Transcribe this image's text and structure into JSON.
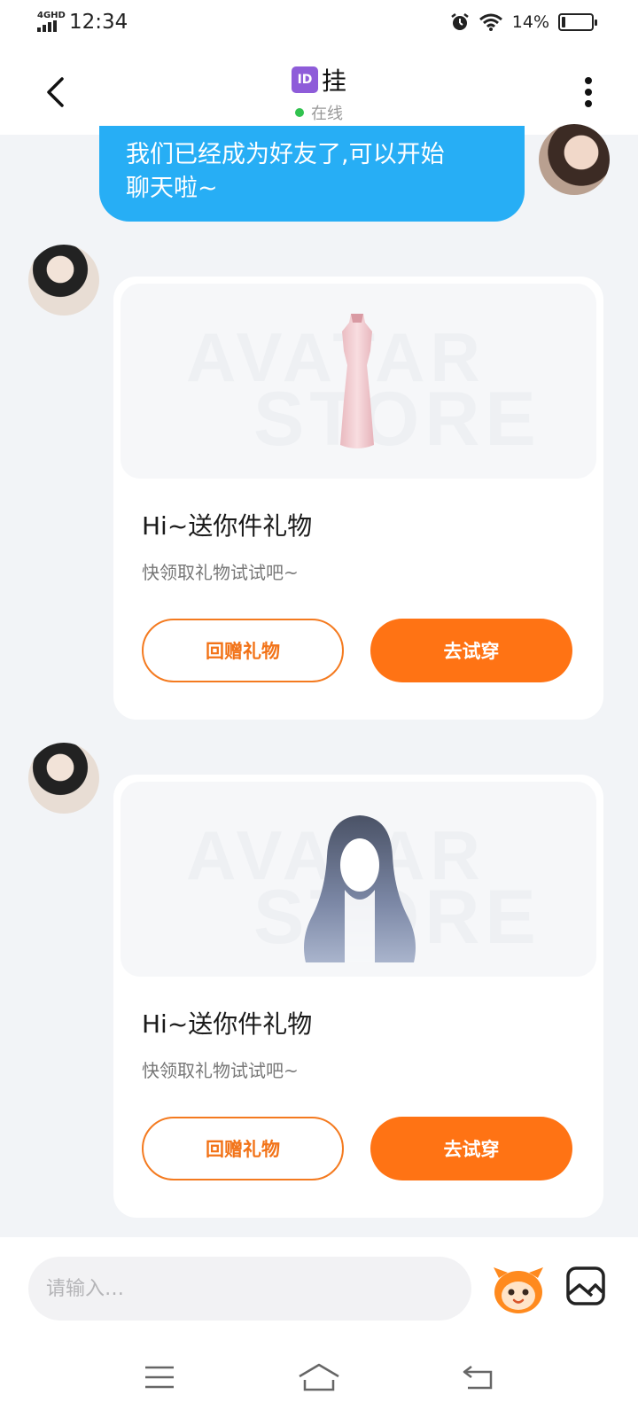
{
  "status_bar": {
    "network": "4GHD",
    "time": "12:34",
    "battery_text": "14%",
    "battery_level": 0.14
  },
  "header": {
    "id_badge": "ID",
    "name": "挂",
    "status": "在线",
    "status_color": "#31c24f"
  },
  "messages": {
    "my_text": "我们已经成为好友了,可以开始聊天啦~",
    "my_text_line1": "我们已经成为好友了,可以开始",
    "my_text_line2": "聊天啦~",
    "bubble_color": "#27aef5"
  },
  "gifts": [
    {
      "item": "dress",
      "watermark_1": "AVATAR",
      "watermark_2": "STORE",
      "title": "Hi~送你件礼物",
      "subtitle": "快领取礼物试试吧~",
      "return_gift_label": "回赠礼物",
      "try_on_label": "去试穿"
    },
    {
      "item": "wig",
      "watermark_1": "AVATAR",
      "watermark_2": "STORE",
      "title": "Hi~送你件礼物",
      "subtitle": "快领取礼物试试吧~",
      "return_gift_label": "回赠礼物",
      "try_on_label": "去试穿"
    }
  ],
  "input": {
    "placeholder": "请输入…"
  },
  "icons": {
    "back": "chevron-left-icon",
    "more": "more-vertical-icon",
    "mascot": "mascot-emoji-icon",
    "image": "image-icon",
    "menu": "menu-icon",
    "home": "home-icon",
    "return": "return-icon"
  },
  "colors": {
    "accent": "#ff7314",
    "accent_outline": "#f47a1f"
  }
}
